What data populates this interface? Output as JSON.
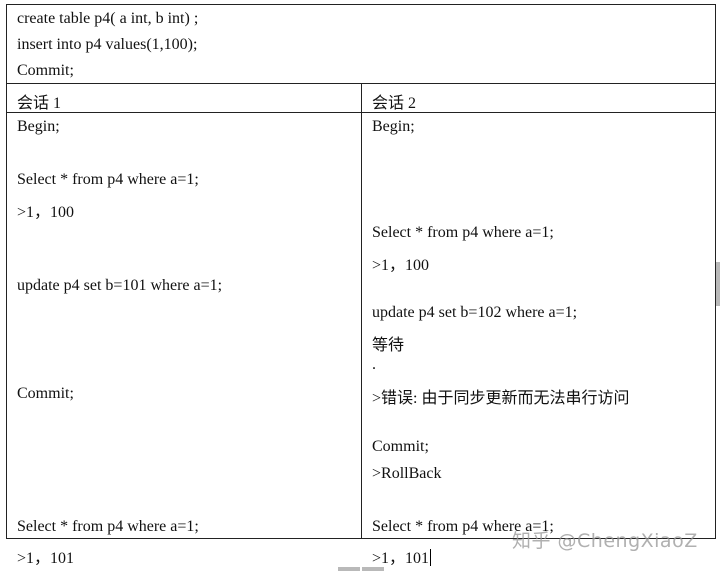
{
  "setup_lines": [
    "create table p4( a int, b int) ;",
    "insert into p4 values(1,100);",
    "Commit;"
  ],
  "session1": {
    "header": "会话 1",
    "lines": [
      "Begin;",
      "Select * from p4 where a=1;",
      ">1，100",
      "update p4 set b=101 where a=1;",
      "Commit;",
      "Select * from p4 where a=1;",
      ">1，101"
    ]
  },
  "session2": {
    "header": "会话 2",
    "lines": [
      "Begin;",
      "Select * from p4 where a=1;",
      ">1，100",
      "update p4 set b=102 where a=1;",
      "等待",
      ".",
      ">错误:   由于同步更新而无法串行访问",
      "Commit;",
      ">RollBack",
      "Select * from p4 where a=1;",
      ">1，101"
    ]
  },
  "watermark": "知乎 @ChengXiaoZ"
}
